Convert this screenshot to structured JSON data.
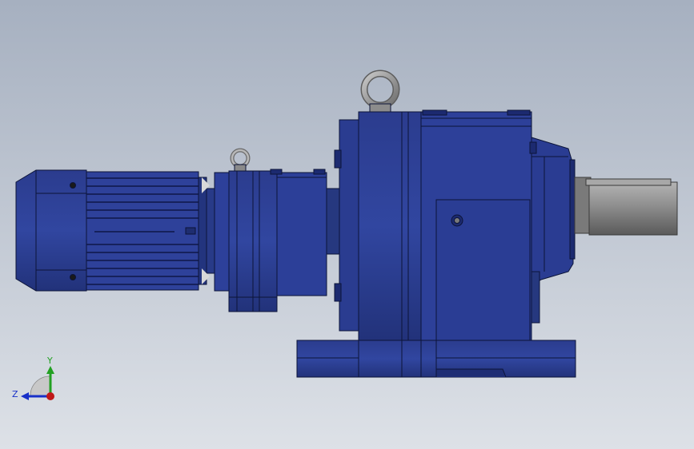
{
  "viewport": {
    "background_top": "#a6b0c0",
    "background_bottom": "#dde1e7"
  },
  "model": {
    "body_color": "#2c3f94",
    "body_dark": "#1b2866",
    "edge_color": "#0c1438",
    "steel_color": "#8a8a8a",
    "eyebolt_color": "#9a9a9a"
  },
  "triad": {
    "y_label": "Y",
    "z_label": "Z",
    "y_color": "#22a022",
    "z_color": "#1830c8",
    "origin_color": "#c01818"
  }
}
